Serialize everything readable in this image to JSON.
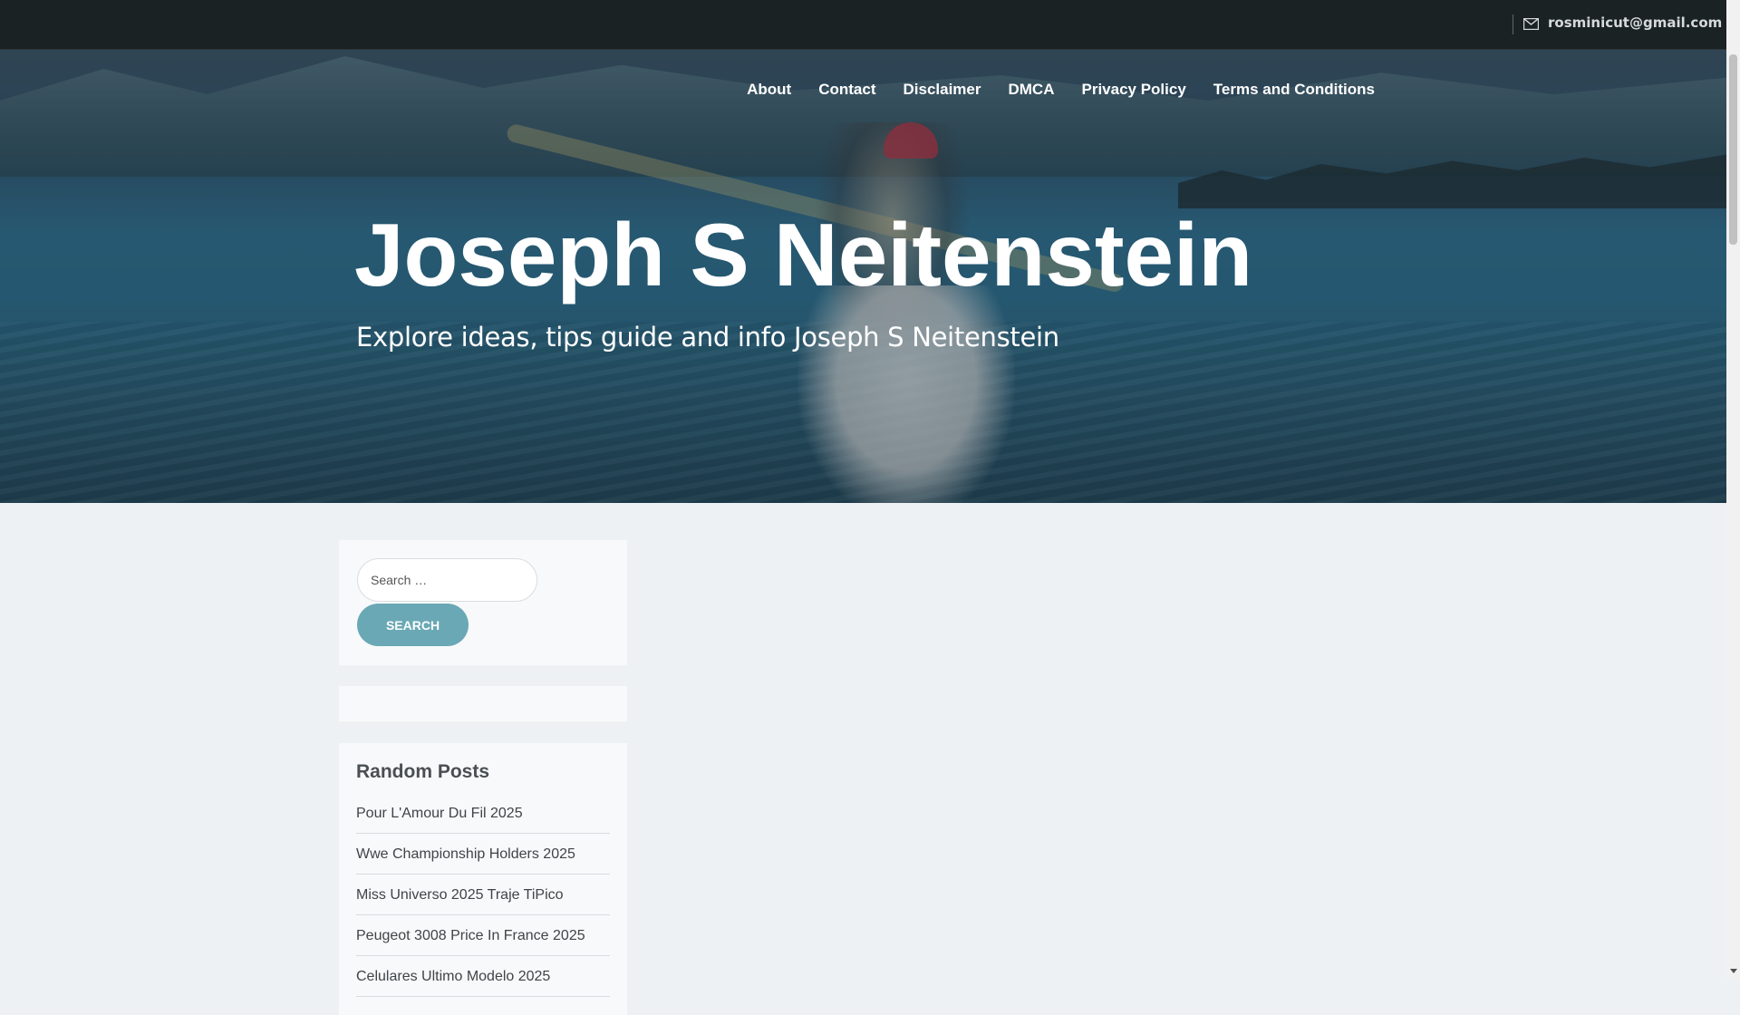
{
  "topbar": {
    "email": "rosminicut@gmail.com",
    "icon": "mail-icon"
  },
  "nav": {
    "items": [
      "About",
      "Contact",
      "Disclaimer",
      "DMCA",
      "Privacy Policy",
      "Terms and Conditions"
    ]
  },
  "hero": {
    "title": "Joseph S Neitenstein",
    "tagline": "Explore ideas, tips guide and info Joseph S Neitenstein"
  },
  "search": {
    "placeholder": "Search …",
    "button_label": "SEARCH"
  },
  "random_posts": {
    "heading": "Random Posts",
    "items": [
      "Pour L'Amour Du Fil 2025",
      "Wwe Championship Holders 2025",
      "Miss Universo 2025 Traje TiPico",
      "Peugeot 3008 Price In France 2025",
      "Celulares Ultimo Modelo 2025"
    ]
  },
  "colors": {
    "topbar_bg": "#1b2224",
    "page_bg": "#eef1f4",
    "search_button": "#6aa8b5"
  }
}
